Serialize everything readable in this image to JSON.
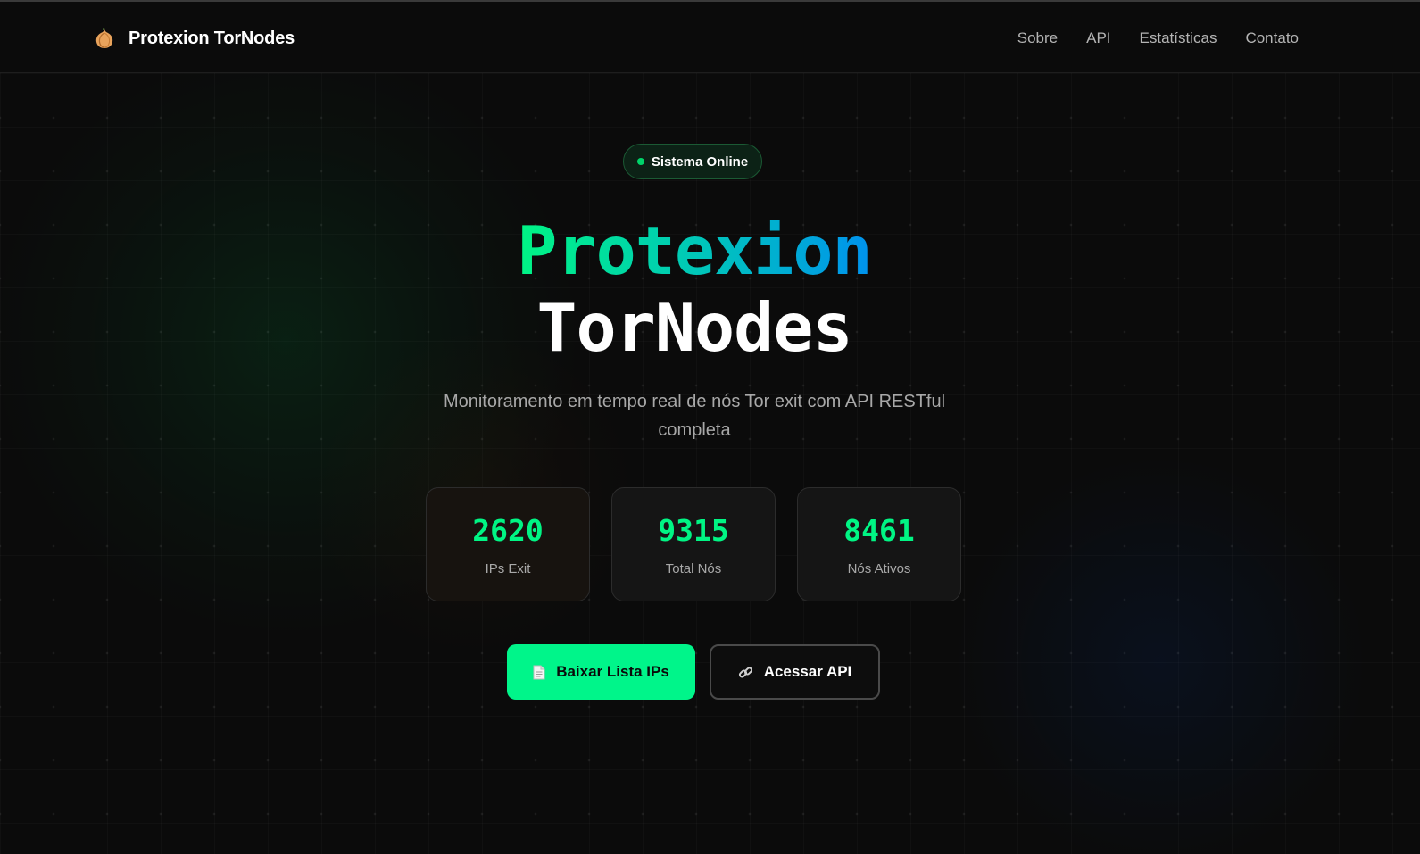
{
  "header": {
    "brand_name": "Protexion TorNodes",
    "brand_icon": "onion-icon",
    "nav": [
      {
        "label": "Sobre"
      },
      {
        "label": "API"
      },
      {
        "label": "Estatísticas"
      },
      {
        "label": "Contato"
      }
    ]
  },
  "hero": {
    "status_badge": "Sistema Online",
    "title_line1": "Protexion",
    "title_line2": "TorNodes",
    "subtitle": "Monitoramento em tempo real de nós Tor exit com API RESTful completa"
  },
  "stats": [
    {
      "value": "2620",
      "label": "IPs Exit"
    },
    {
      "value": "9315",
      "label": "Total Nós"
    },
    {
      "value": "8461",
      "label": "Nós Ativos"
    }
  ],
  "buttons": {
    "download_label": "Baixar Lista IPs",
    "download_icon": "document-icon",
    "api_label": "Acessar API",
    "api_icon": "link-icon"
  },
  "colors": {
    "accent": "#00f584",
    "gradient_end": "#0092ee",
    "background": "#0a0a0a"
  }
}
